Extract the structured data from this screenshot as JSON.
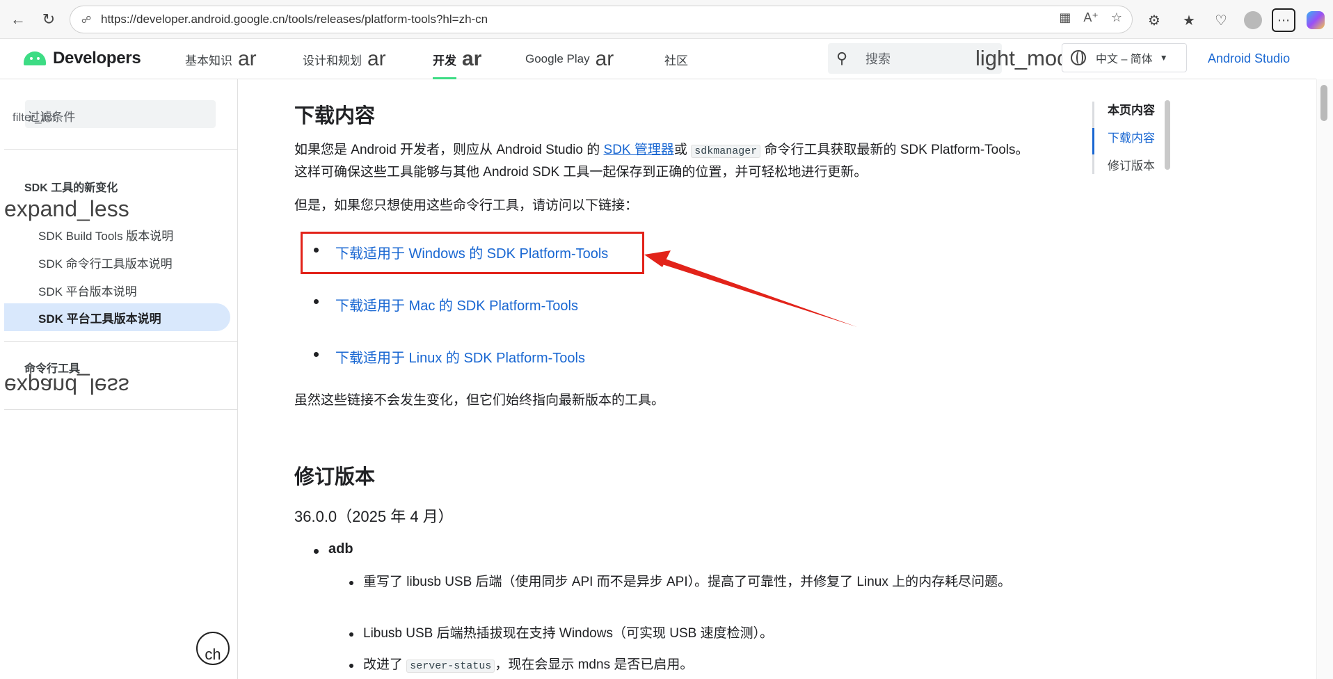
{
  "browser": {
    "url": "https://developer.android.google.cn/tools/releases/platform-tools?hl=zh-cn"
  },
  "header": {
    "logo_text": "Developers",
    "tabs": [
      {
        "label": "基本知识",
        "ligature": "ar"
      },
      {
        "label": "设计和规划",
        "ligature": "ar"
      },
      {
        "label": "开发",
        "ligature": "ar"
      },
      {
        "label": "Google Play",
        "ligature": "ar"
      },
      {
        "label": "社区",
        "ligature": ""
      }
    ],
    "search_placeholder": "搜索",
    "light_mode_ligature": "light_mode",
    "language": "中文 – 简体",
    "android_studio_link": "Android Studio"
  },
  "sidebar": {
    "filter_ligature": "filter_list",
    "filter_placeholder": "过滤条件",
    "section1_title": "SDK 工具的新变化",
    "expand_ligature": "expand_less",
    "items": [
      {
        "label": "SDK Build Tools 版本说明"
      },
      {
        "label": "SDK 命令行工具版本说明"
      },
      {
        "label": "SDK 平台版本说明"
      },
      {
        "label": "SDK 平台工具版本说明"
      }
    ],
    "section2_title": "命令行工具",
    "chat_ligature": "ch"
  },
  "article": {
    "h_download": "下载内容",
    "intro_pre": "如果您是 Android 开发者，则应从 Android Studio 的 ",
    "intro_link": "SDK 管理器",
    "intro_or": "或",
    "intro_code": "sdkmanager",
    "intro_post": " 命令行工具获取最新的 SDK Platform-Tools。这样可确保这些工具能够与其他 Android SDK 工具一起保存到正确的位置，并可轻松地进行更新。",
    "only_tools": "但是，如果您只想使用这些命令行工具，请访问以下链接：",
    "links": [
      {
        "label": "下载适用于 Windows 的 SDK Platform-Tools"
      },
      {
        "label": "下载适用于 Mac 的 SDK Platform-Tools"
      },
      {
        "label": "下载适用于 Linux 的 SDK Platform-Tools"
      }
    ],
    "links_note": "虽然这些链接不会发生变化，但它们始终指向最新版本的工具。",
    "h_revisions": "修订版本",
    "version": "36.0.0（2025 年 4 月）",
    "adb": "adb",
    "changes": [
      "重写了 libusb USB 后端（使用同步 API 而不是异步 API）。提高了可靠性，并修复了 Linux 上的内存耗尽问题。",
      "Libusb USB 后端热插拔现在支持 Windows（可实现 USB 速度检测）。"
    ],
    "change3_pre": "改进了",
    "change3_code": "server-status",
    "change3_post": "，现在会显示 mdns 是否已启用。"
  },
  "toc": {
    "head": "本页内容",
    "items": [
      "下载内容",
      "修订版本"
    ]
  },
  "colors": {
    "link": "#1967d2",
    "annotation_red": "#e2231a",
    "active_nav_bg": "#d9e8fc",
    "android_green": "#3ddc84"
  }
}
